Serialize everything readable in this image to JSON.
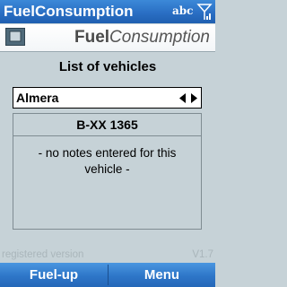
{
  "status_bar": {
    "title": "FuelConsumption",
    "input_mode": "abc",
    "signal_icon": "signal-strength-icon"
  },
  "header": {
    "app_icon": "app-icon",
    "brand_bold": "Fuel",
    "brand_italic": "Consumption"
  },
  "main": {
    "title": "List of vehicles",
    "vehicle_select": {
      "value": "Almera",
      "arrows_icon": "left-right-arrows-icon"
    },
    "vehicle": {
      "plate": "B-XX 1365",
      "notes": "- no notes entered for this vehicle -"
    }
  },
  "footer": {
    "registration": "registered version",
    "version": "V1.7"
  },
  "softkeys": {
    "left": "Fuel-up",
    "right": "Menu"
  },
  "colors": {
    "background": "#c6d2d7",
    "bar_blue": "#2a6fc4",
    "muted_text": "#aab6bb"
  }
}
